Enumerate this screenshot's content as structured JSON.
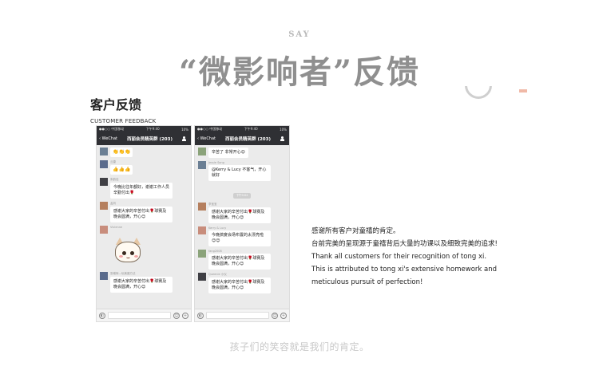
{
  "header": {
    "say": "SAY",
    "title": "“微影响者”反馈",
    "section_title": "客户反馈",
    "section_subtitle": "CUSTOMER FEEDBACK"
  },
  "phone_left": {
    "status": {
      "carrier": "●●○○ 中国移动",
      "time": "下午9:40",
      "battery": "10%"
    },
    "nav": {
      "back": "‹ WeChat",
      "title": "西丽会员精英群 (203)"
    },
    "messages": [
      {
        "sender": "",
        "text": "👏👏👏"
      },
      {
        "sender": "云婕",
        "text": "👍👍👍"
      },
      {
        "sender": "朱韵佳",
        "text": "今晚比往年都好，谢谢工作人员辛勤付出🌹"
      },
      {
        "sender": "孟妈",
        "text": "感谢大家的辛苦付出🌹球赛及晚会圆满，开心😊"
      },
      {
        "sender": "Vivienne",
        "text": ""
      },
      {
        "sender": "张曦辉—玩美魔方法",
        "text": "感谢大家的辛苦付出🌹球赛及晚会圆满，开心😊"
      }
    ]
  },
  "phone_right": {
    "status": {
      "carrier": "●●○○ 中国移动",
      "time": "下午9:40",
      "battery": "10%"
    },
    "nav": {
      "back": "‹ WeChat",
      "title": "西丽会员精英群 (203)"
    },
    "messages": [
      {
        "sender": "",
        "text": "辛苦了 非常开心😊"
      },
      {
        "sender": "Jessie Song",
        "text": "@Kerry & Lucy 不客气，开心就好"
      },
      {
        "sender": "李宝宝",
        "text": "感谢大家的辛苦付出🌹球赛及晚会圆满，开心😊"
      },
      {
        "sender": "Kerry & Lucy",
        "text": "今晚搞宴会场布置的太漂亮啦😊😊"
      },
      {
        "sender": "fang2008",
        "text": "感谢大家的辛苦付出🌹球赛及晚会圆满，开心😊"
      },
      {
        "sender": "Queenie 小仪",
        "text": "感谢大家的辛苦付出🌹球赛及晚会圆满，开心😊"
      }
    ],
    "time_stamp": "下午9:02"
  },
  "description": {
    "line1": "感谢所有客户对童禧的肯定。",
    "line2": "台前完美的呈现源于童禧背后大量的功课以及细致完美的追求!",
    "line3": "Thank all customers for their recognition of tong xi.",
    "line4": "This is attributed to tong xi's extensive homework and",
    "line5": "meticulous pursuit of perfection!"
  },
  "footer": "孩子们的笑容就是我们的肯定。",
  "colors": {
    "title_gray": "#8f8f8f",
    "wechat_dark": "#2f3034",
    "chat_bg": "#ebebeb"
  }
}
